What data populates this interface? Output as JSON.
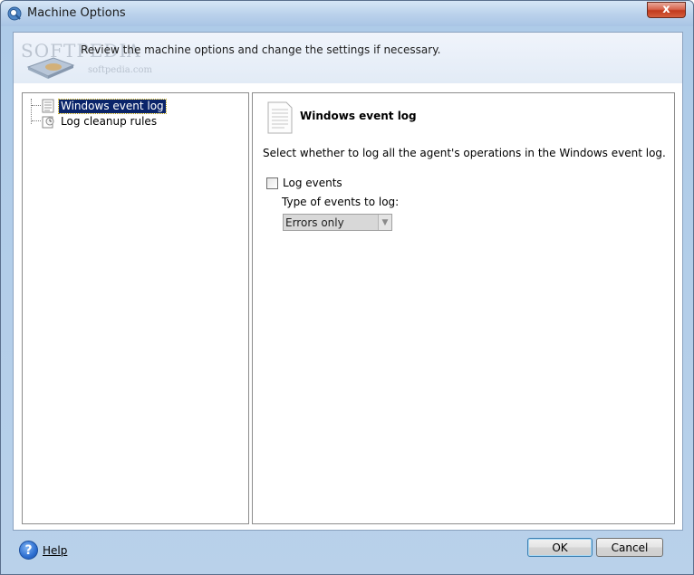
{
  "window": {
    "title": "Machine Options",
    "close_label": "x"
  },
  "header": {
    "description": "Review the machine options and change the settings if necessary.",
    "watermark_big": "SOFTPEDIA",
    "watermark_small": "softpedia.com"
  },
  "tree": {
    "items": [
      {
        "label": "Windows event log",
        "icon": "event-log-icon",
        "selected": true
      },
      {
        "label": "Log cleanup rules",
        "icon": "cleanup-rules-icon",
        "selected": false
      }
    ]
  },
  "details": {
    "title": "Windows event log",
    "icon": "document-icon",
    "description": "Select whether to log all the agent's operations in the Windows event log.",
    "log_events_label": "Log events",
    "log_events_checked": false,
    "type_label": "Type of events to log:",
    "type_value": "Errors only"
  },
  "footer": {
    "help_label": "Help",
    "ok_label": "OK",
    "cancel_label": "Cancel"
  },
  "colors": {
    "selection": "#0a246a",
    "close_button": "#c1391c",
    "window_frame": "#b9d1ea"
  }
}
